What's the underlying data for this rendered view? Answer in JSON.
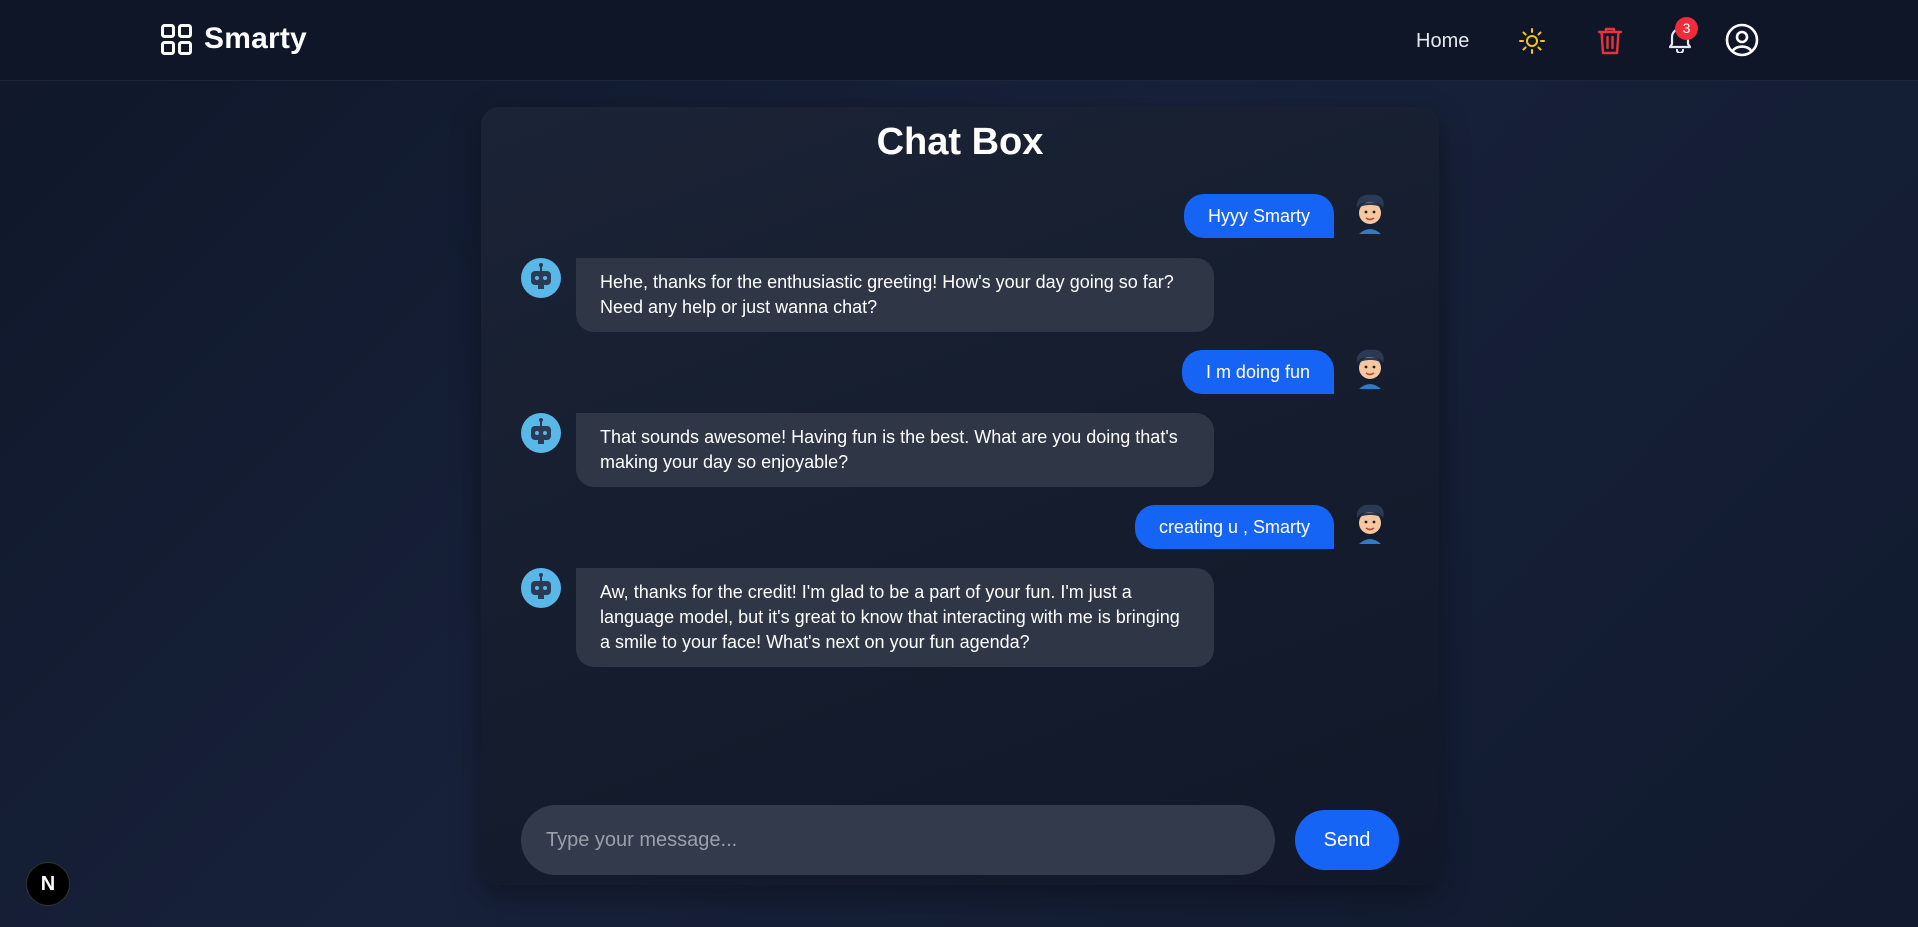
{
  "app": {
    "name": "Smarty"
  },
  "nav": {
    "home_label": "Home",
    "notification_count": "3"
  },
  "chat": {
    "title": "Chat Box",
    "messages": [
      {
        "role": "user",
        "text": "Hyyy Smarty"
      },
      {
        "role": "bot",
        "text": "Hehe, thanks for the enthusiastic greeting! How's your day going so far? Need any help or just wanna chat?"
      },
      {
        "role": "user",
        "text": "I m doing fun"
      },
      {
        "role": "bot",
        "text": "That sounds awesome! Having fun is the best. What are you doing that's making your day so enjoyable?"
      },
      {
        "role": "user",
        "text": "creating u , Smarty"
      },
      {
        "role": "bot",
        "text": "Aw, thanks for the credit! I'm glad to be a part of your fun. I'm just a language model, but it's great to know that interacting with me is bringing a smile to your face! What's next on your fun agenda?"
      }
    ],
    "input_placeholder": "Type your message...",
    "input_value": "",
    "send_label": "Send"
  },
  "dev_badge": {
    "label": "N"
  },
  "colors": {
    "accent": "#1664f6",
    "bot_bubble": "#2f3646",
    "trash": "#e8323d",
    "sun": "#f5c518",
    "badge": "#ef2b3c"
  },
  "icons": [
    "grid-icon",
    "sun-icon",
    "trash-icon",
    "bell-icon",
    "user-circle-icon",
    "bot-avatar-icon",
    "user-avatar-icon"
  ]
}
